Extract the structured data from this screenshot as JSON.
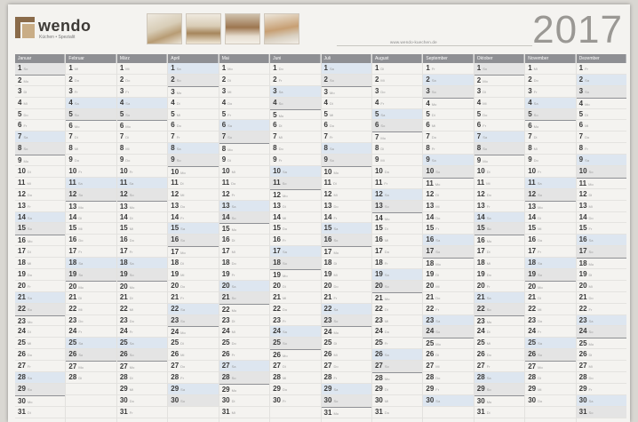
{
  "brand": {
    "name": "wendo",
    "tagline": "Küchen • Spezialit"
  },
  "header": {
    "year": "2017",
    "website": "www.wendo-kuechen.de"
  },
  "months": [
    "Januar",
    "Februar",
    "März",
    "April",
    "Mai",
    "Juni",
    "Juli",
    "August",
    "September",
    "Oktober",
    "November",
    "Dezember"
  ],
  "weekday_abbr": [
    "Mo",
    "Di",
    "Mi",
    "Do",
    "Fr",
    "Sa",
    "So"
  ],
  "month_lengths": [
    31,
    28,
    31,
    30,
    31,
    30,
    31,
    31,
    30,
    31,
    30,
    31
  ],
  "first_weekday_index": [
    6,
    2,
    2,
    5,
    0,
    3,
    5,
    1,
    4,
    6,
    2,
    4
  ],
  "colors": {
    "header_bar": "#8e8f93",
    "saturday": "#dde6f0",
    "sunday": "#e4e4e4",
    "year_text": "#9a9894",
    "brand": "#8a6b4a"
  }
}
